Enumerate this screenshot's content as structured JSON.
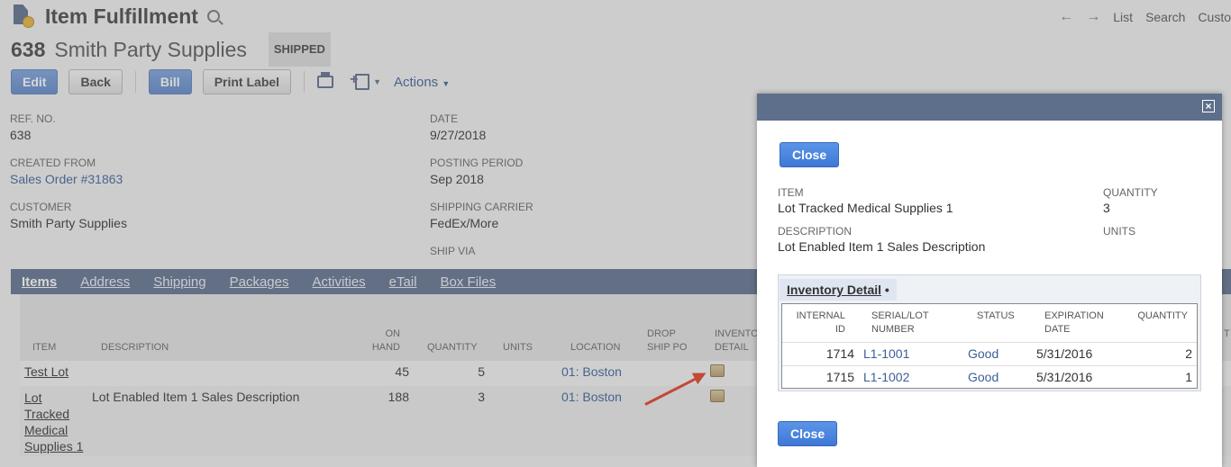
{
  "header": {
    "record_type": "Item Fulfillment",
    "record_number": "638",
    "record_name": "Smith Party Supplies",
    "status": "SHIPPED"
  },
  "topnav": {
    "list": "List",
    "search": "Search",
    "customize": "Custo"
  },
  "buttons": {
    "edit": "Edit",
    "back": "Back",
    "bill": "Bill",
    "print_label": "Print Label",
    "actions": "Actions"
  },
  "fields": {
    "ref_no_label": "REF. NO.",
    "ref_no": "638",
    "created_from_label": "CREATED FROM",
    "created_from": "Sales Order #31863",
    "customer_label": "CUSTOMER",
    "customer": "Smith Party Supplies",
    "date_label": "DATE",
    "date": "9/27/2018",
    "posting_period_label": "POSTING PERIOD",
    "posting_period": "Sep 2018",
    "shipping_carrier_label": "SHIPPING CARRIER",
    "shipping_carrier": "FedEx/More",
    "ship_via_label": "SHIP VIA"
  },
  "tabs": [
    "Items",
    "Address",
    "Shipping",
    "Packages",
    "Activities",
    "eTail",
    "Box Files"
  ],
  "items_grid": {
    "headers": {
      "item": "ITEM",
      "description": "DESCRIPTION",
      "on": "ON",
      "hand": "HAND",
      "quantity": "QUANTITY",
      "units": "UNITS",
      "location": "LOCATION",
      "drop": "DROP",
      "ship_po": "SHIP PO",
      "invento": "INVENTO",
      "detail": "DETAIL",
      "extra": "T"
    },
    "rows": [
      {
        "item": "Test Lot",
        "description": "",
        "on_hand": "45",
        "quantity": "5",
        "location": "01: Boston"
      },
      {
        "item_lines": [
          "Lot",
          "Tracked",
          "Medical",
          "Supplies 1"
        ],
        "description": "Lot Enabled Item 1 Sales Description",
        "on_hand": "188",
        "quantity": "3",
        "location": "01: Boston"
      }
    ]
  },
  "modal": {
    "close_label": "Close",
    "close_x": "×",
    "item_label": "ITEM",
    "item": "Lot Tracked Medical Supplies 1",
    "quantity_label": "QUANTITY",
    "quantity": "3",
    "description_label": "DESCRIPTION",
    "description": "Lot Enabled Item 1 Sales Description",
    "units_label": "UNITS",
    "inventory_detail_tab": "Inventory Detail",
    "inventory_detail_marker": "•",
    "inv_headers": {
      "internal": "INTERNAL",
      "id": "ID",
      "serial_lot": "SERIAL/LOT",
      "number": "NUMBER",
      "status": "STATUS",
      "expiration": "EXPIRATION",
      "date": "DATE",
      "quantity": "QUANTITY"
    },
    "inv_rows": [
      {
        "internal_id": "1714",
        "serial": "L1-1001",
        "status": "Good",
        "expiration": "5/31/2016",
        "quantity": "2"
      },
      {
        "internal_id": "1715",
        "serial": "L1-1002",
        "status": "Good",
        "expiration": "5/31/2016",
        "quantity": "1"
      }
    ]
  },
  "colors": {
    "header_bar": "#5e6f8c",
    "primary_button": "#3f78d6",
    "link": "#3a5f9a",
    "annotation_arrow": "#e23b21"
  }
}
